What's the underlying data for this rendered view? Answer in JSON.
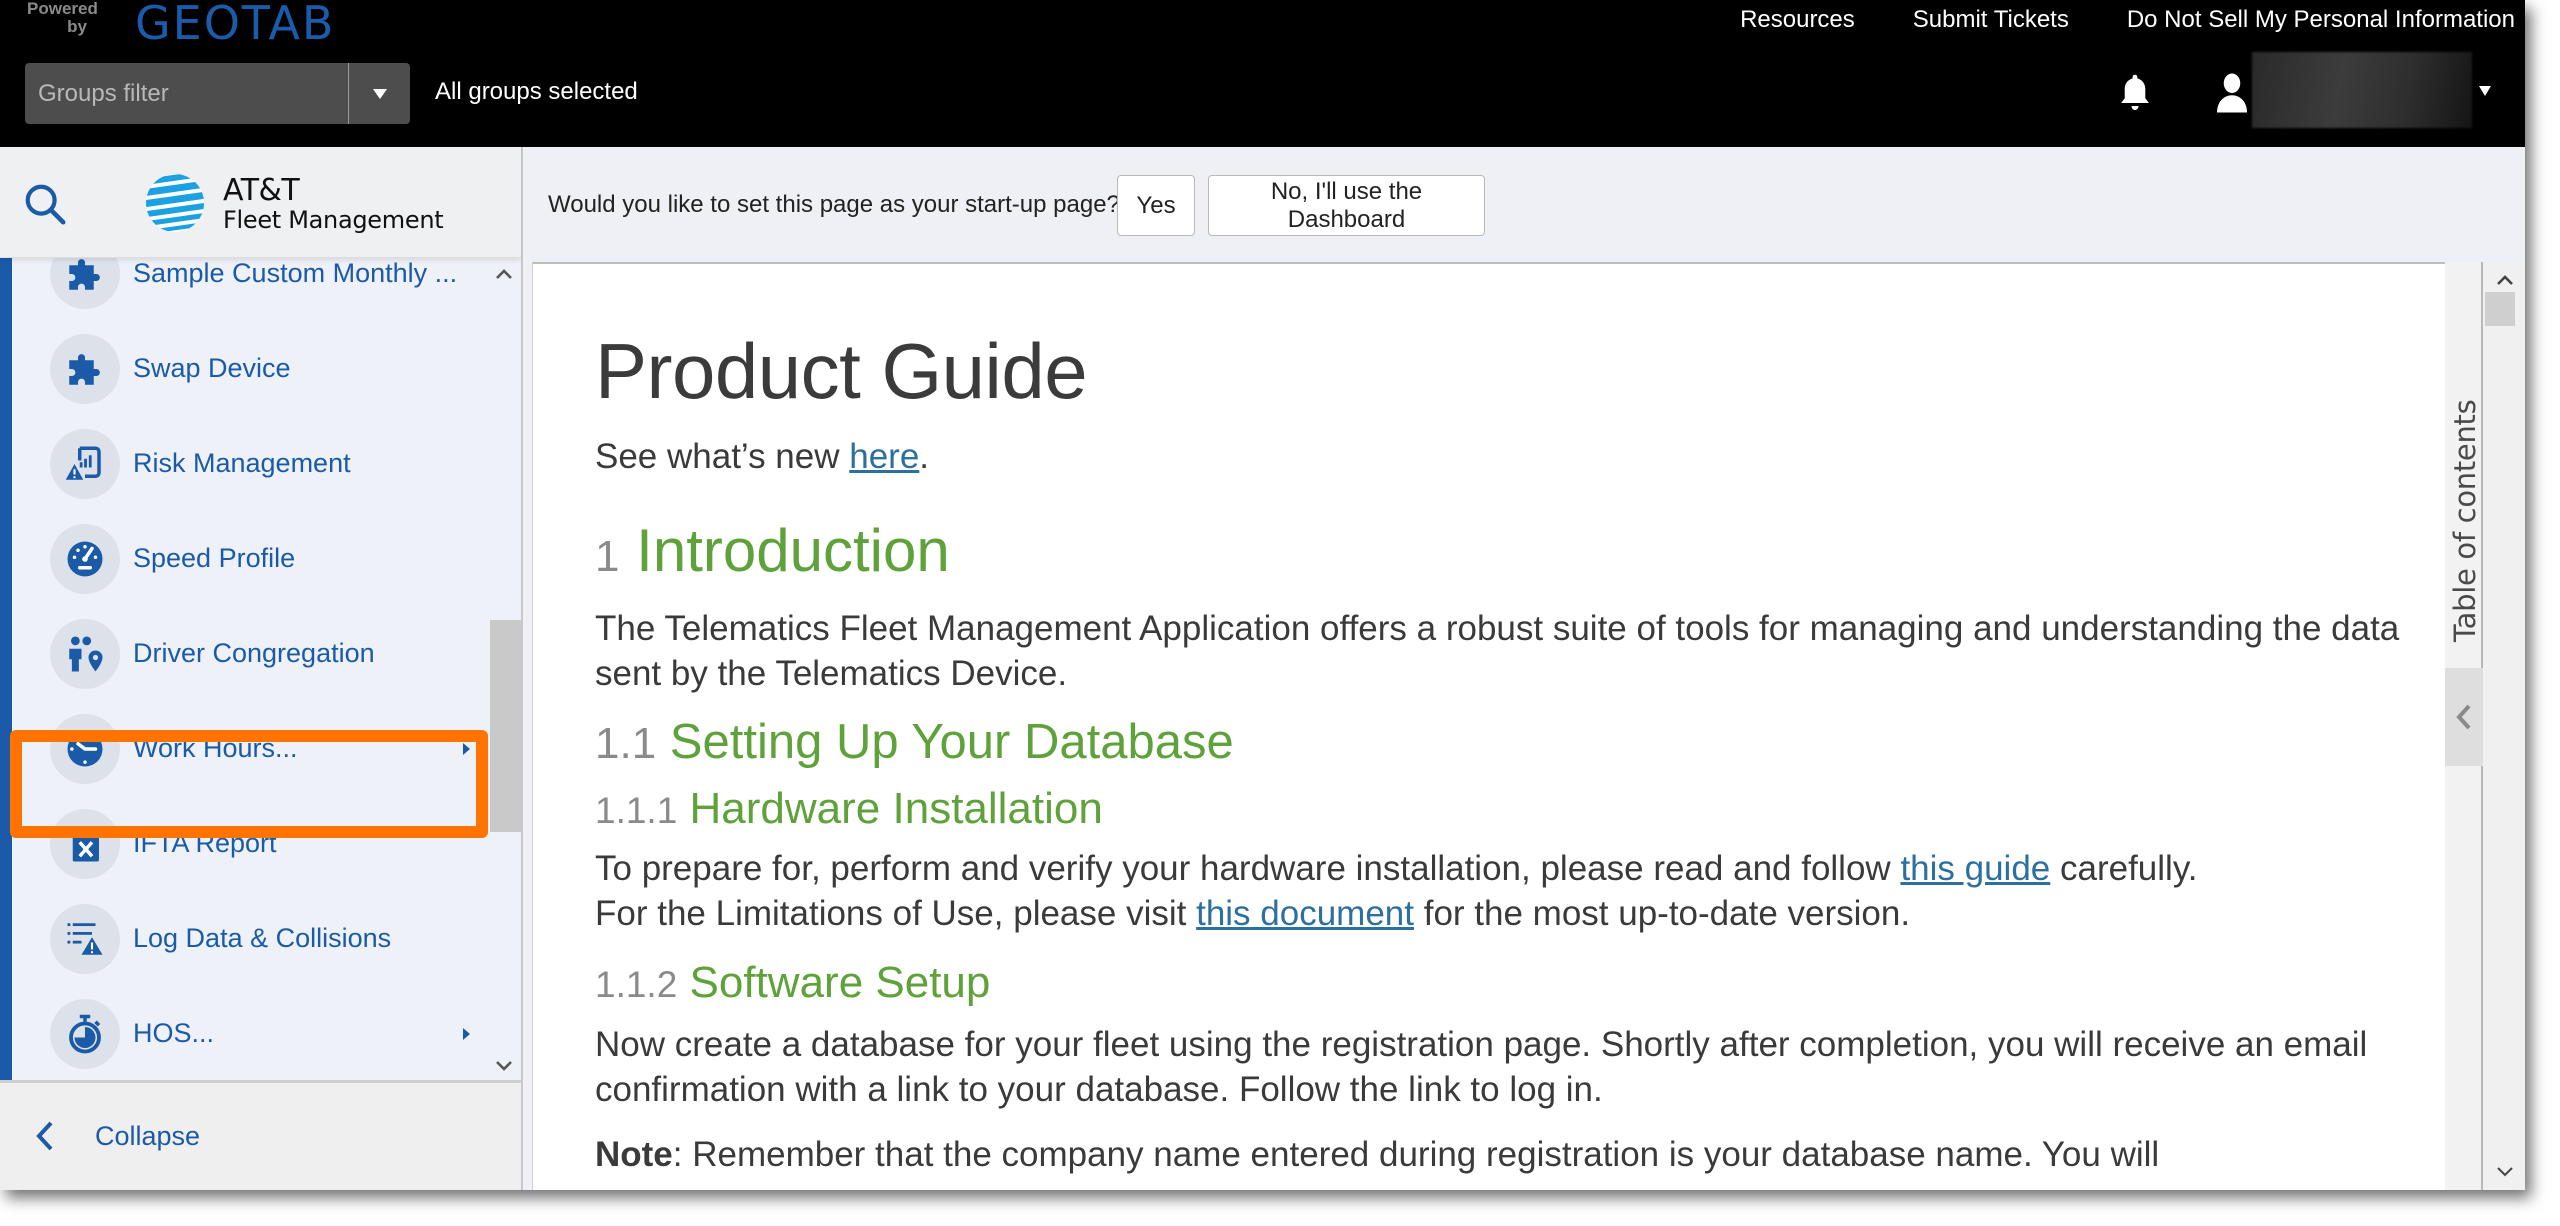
{
  "topbar": {
    "powered_by": "Powered by",
    "brand": "GEOTAB",
    "links": [
      "Resources",
      "Submit Tickets",
      "Do Not Sell My Personal Information"
    ],
    "groups_filter": {
      "placeholder": "Groups filter",
      "value": ""
    },
    "groups_status": "All groups selected",
    "icons": {
      "notifications": "bell-icon",
      "user": "user-icon",
      "menu": "caret-down-icon"
    },
    "user_name": ""
  },
  "sidebar": {
    "brand_name": "AT&T",
    "brand_subtitle": "Fleet Management",
    "accent_color": "#1a5aa8",
    "items": [
      {
        "label": "Sample Custom Monthly ...",
        "icon": "puzzle-icon",
        "has_submenu": false
      },
      {
        "label": "Swap Device",
        "icon": "puzzle-icon",
        "has_submenu": false
      },
      {
        "label": "Risk Management",
        "icon": "risk-report-icon",
        "has_submenu": false
      },
      {
        "label": "Speed Profile",
        "icon": "speedometer-icon",
        "has_submenu": false
      },
      {
        "label": "Driver Congregation",
        "icon": "people-location-icon",
        "has_submenu": false
      },
      {
        "label": "Work Hours...",
        "icon": "clock-icon",
        "has_submenu": true,
        "highlighted": true
      },
      {
        "label": "IFTA Report",
        "icon": "fuel-can-icon",
        "has_submenu": false
      },
      {
        "label": "Log Data & Collisions",
        "icon": "list-warning-icon",
        "has_submenu": false
      },
      {
        "label": "HOS...",
        "icon": "stopwatch-icon",
        "has_submenu": true
      }
    ],
    "collapse_label": "Collapse",
    "highlight_color": "#ff7300"
  },
  "prompt": {
    "question": "Would you like to set this page as your start-up page?",
    "yes_label": "Yes",
    "no_label": "No, I'll use the Dashboard"
  },
  "document": {
    "title": "Product Guide",
    "whats_new": {
      "before": "See what’s new ",
      "link": "here",
      "after": "."
    },
    "sections": [
      {
        "number": "1",
        "title": "Introduction"
      },
      {
        "number": "1.1",
        "title": "Setting Up Your Database"
      },
      {
        "number": "1.1.1",
        "title": "Hardware Installation"
      },
      {
        "number": "1.1.2",
        "title": "Software Setup"
      }
    ],
    "intro_text": "The Telematics Fleet Management Application offers a robust suite of tools for managing and understanding the data sent by the Telematics Device.",
    "hardware_text": {
      "p1_before": "To prepare for, perform and verify your hardware installation, please read and follow ",
      "p1_link": "this guide",
      "p1_after": " carefully.",
      "p2_before": "For the Limitations of Use, please visit ",
      "p2_link": "this document",
      "p2_after": " for the most up-to-date version."
    },
    "software_text": "Now create a database for your fleet using the registration page. Shortly after completion, you will receive an email confirmation with a link to your database. Follow the link to log in.",
    "note_label": "Note",
    "note_text": ": Remember that the company name entered during registration is your database name. You will",
    "heading_color": "#5fa23b",
    "number_color": "#8a8a8a",
    "link_color": "#2d6f9f"
  },
  "toc": {
    "label": "Table of contents"
  }
}
